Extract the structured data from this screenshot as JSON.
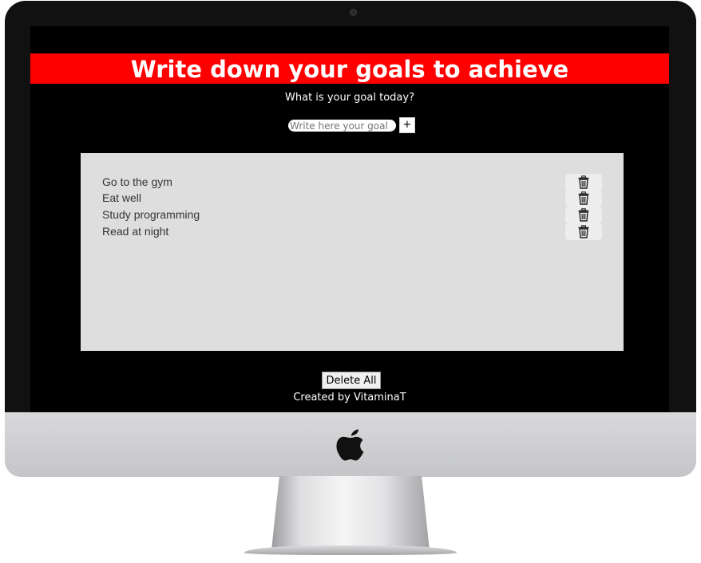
{
  "header": {
    "title": "Write down your goals to achieve",
    "question": "What is your goal today?"
  },
  "input": {
    "placeholder": "Write here your goal",
    "value": "",
    "add_label": "+"
  },
  "goals": [
    {
      "text": "Go to the gym",
      "delete_icon": "trash-icon"
    },
    {
      "text": "Eat well",
      "delete_icon": "trash-icon"
    },
    {
      "text": "Study programming",
      "delete_icon": "trash-icon"
    },
    {
      "text": "Read at night",
      "delete_icon": "trash-icon"
    }
  ],
  "footer": {
    "delete_all_label": "Delete All",
    "credits": "Created by VitaminaT"
  },
  "colors": {
    "header_bar": "#ff0000",
    "screen_background": "#000000",
    "panel_background": "#dedede"
  }
}
